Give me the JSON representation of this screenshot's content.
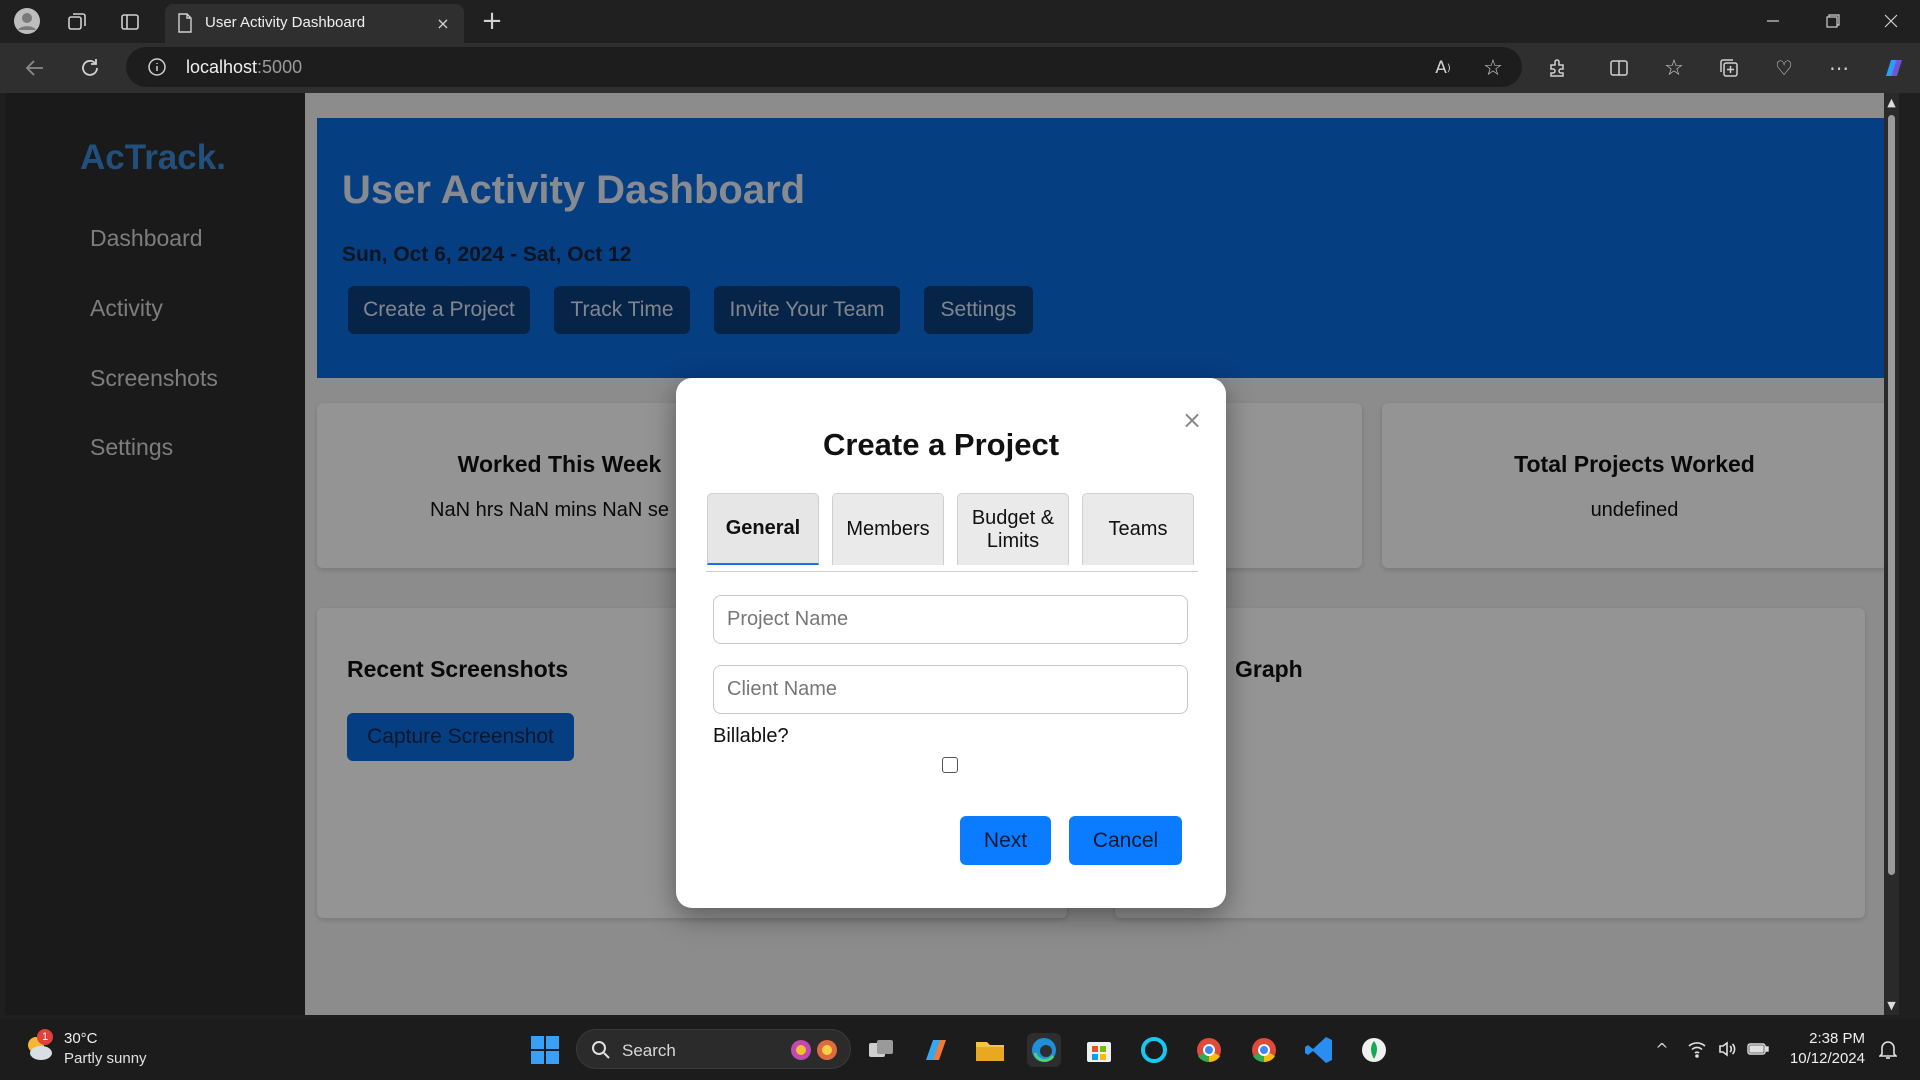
{
  "browser": {
    "tab_title": "User Activity Dashboard",
    "tab_close": "×",
    "new_tab": "+",
    "url_host": "localhost",
    "url_port": ":5000"
  },
  "sidebar": {
    "brand": "AcTrack.",
    "items": [
      {
        "label": "Dashboard"
      },
      {
        "label": "Activity"
      },
      {
        "label": "Screenshots"
      },
      {
        "label": "Settings"
      }
    ]
  },
  "header": {
    "title": "User Activity Dashboard",
    "date_range": "Sun, Oct 6, 2024 - Sat, Oct 12",
    "buttons": [
      {
        "label": "Create a Project"
      },
      {
        "label": "Track Time"
      },
      {
        "label": "Invite Your Team"
      },
      {
        "label": "Settings"
      }
    ]
  },
  "stats": [
    {
      "title": "Worked This Week",
      "value": "NaN hrs NaN mins NaN se"
    },
    {
      "title": "Total Projects Worked",
      "value": "undefined"
    }
  ],
  "screenshots": {
    "title": "Recent Screenshots",
    "capture_label": "Capture Screenshot"
  },
  "graph": {
    "title": "Graph"
  },
  "modal": {
    "title": "Create a Project",
    "close": "×",
    "tabs": [
      {
        "label": "General",
        "active": true
      },
      {
        "label": "Members"
      },
      {
        "label": "Budget & Limits"
      },
      {
        "label": "Teams"
      }
    ],
    "project_name_placeholder": "Project Name",
    "client_name_placeholder": "Client Name",
    "billable_label": "Billable?",
    "next_label": "Next",
    "cancel_label": "Cancel"
  },
  "taskbar": {
    "weather_temp": "30°C",
    "weather_desc": "Partly sunny",
    "weather_badge": "1",
    "search_label": "Search",
    "time": "2:38 PM",
    "date": "10/12/2024"
  },
  "colors": {
    "header_bg": "#0b6be0",
    "sidebar_bg": "#2d2d2d",
    "brand": "#3a8bd8",
    "primary_button": "#0b7bff"
  }
}
